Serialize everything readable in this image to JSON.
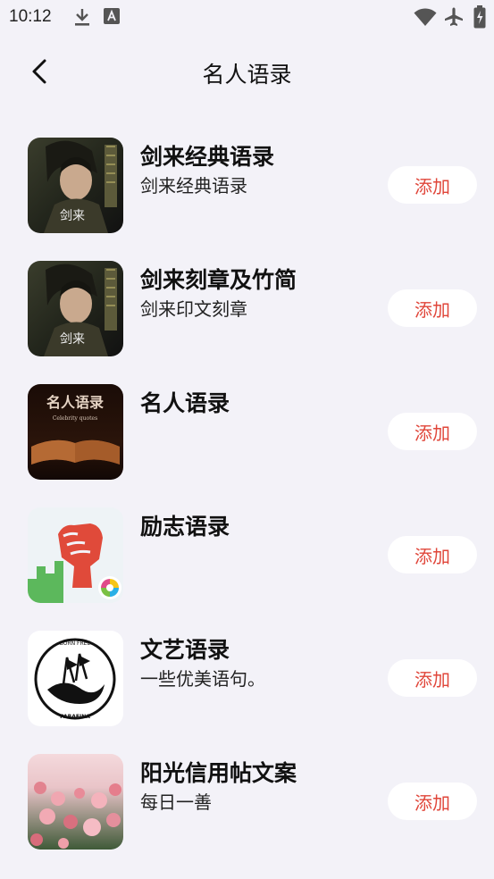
{
  "status_bar": {
    "time": "10:12",
    "icons_left": [
      "download-icon",
      "font-a-icon"
    ],
    "icons_right": [
      "wifi-icon",
      "airplane-mode-icon",
      "battery-charging-icon"
    ]
  },
  "header": {
    "back_icon": "chevron-left-icon",
    "title": "名人语录"
  },
  "colors": {
    "background": "#f3f2f8",
    "accent": "#e0463a",
    "button_bg": "#ffffff"
  },
  "items": [
    {
      "title": "剑来经典语录",
      "subtitle": "剑来经典语录",
      "action": "添加",
      "thumb_text": "剑来"
    },
    {
      "title": "剑来刻章及竹简",
      "subtitle": "剑来印文刻章",
      "action": "添加",
      "thumb_text": "剑来"
    },
    {
      "title": "名人语录",
      "subtitle": "",
      "action": "添加",
      "thumb_text": "名人语录",
      "thumb_subtext": "Celebrity quotes"
    },
    {
      "title": "励志语录",
      "subtitle": "",
      "action": "添加"
    },
    {
      "title": "文艺语录",
      "subtitle": "一些优美语句。",
      "action": "添加",
      "thumb_text": "BORN FREE",
      "thumb_subtext": "PARAFINA"
    },
    {
      "title": "阳光信用帖文案",
      "subtitle": "每日一善",
      "action": "添加"
    }
  ]
}
